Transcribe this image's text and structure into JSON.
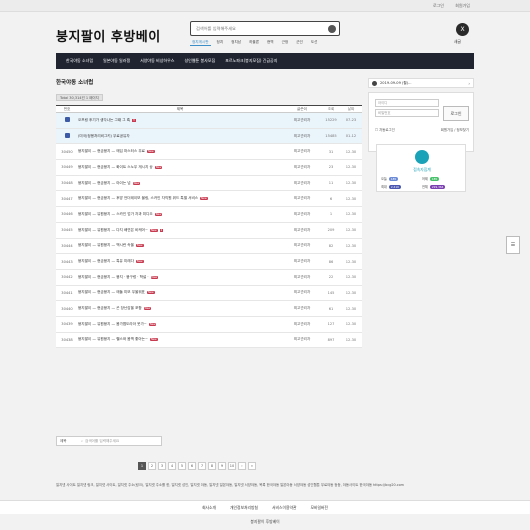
{
  "top_links": [
    "로그인",
    "회원가입"
  ],
  "logo": "붕지팔이 후방베이",
  "search": {
    "placeholder": "검색어를 입력해주세요"
  },
  "search_tabs": [
    "정치게시판",
    "정치",
    "정치남",
    "하울론",
    "현역",
    "근정",
    "군인",
    "도선"
  ],
  "user": {
    "avatar": "X",
    "label": "새글"
  },
  "nav": [
    "한국야동 소녀럽",
    "일본야동 일러쟁",
    "서양야동 비상하우스",
    "성인웹툰 봉사모집",
    "포르노파크(붕지모집) 긴급공지"
  ],
  "board": {
    "title": "한국야동 소녀럽",
    "total": "Total 30,314건 1 페이지",
    "headers": {
      "no": "번호",
      "title": "제목",
      "author": "글쓴이",
      "views": "조회",
      "date": "날짜"
    },
    "rows": [
      {
        "no": "",
        "notice": true,
        "title": "오프링 후기가 생각나는 그때 그 혹",
        "cnt": "3",
        "author": "최고관리자",
        "views": "15229",
        "date": "07-23"
      },
      {
        "no": "",
        "notice": true,
        "title": "(미국)정용처리비그키) 무료공유자",
        "cnt": "",
        "author": "최고관리자",
        "views": "15485",
        "date": "01-12"
      },
      {
        "no": "30450",
        "title": "붕지팔이 — 현금붕지 — 매입 마스터스 무료",
        "badge": "New",
        "author": "최고관리자",
        "views": "31",
        "date": "12-30"
      },
      {
        "no": "30449",
        "title": "붕지팔이 — 현금붕지 — 화이트 스노우 게시지 상",
        "badge": "New",
        "author": "최고관리자",
        "views": "23",
        "date": "12-30"
      },
      {
        "no": "30448",
        "title": "붕지팔이 — 현금붕지 — 야이는 넘",
        "badge": "New",
        "author": "최고관리자",
        "views": "11",
        "date": "12-30"
      },
      {
        "no": "30447",
        "title": "붕지팔이 — 현금붕지 — 후방 언더테이보 블링, 스카인 자직원 위드 특별 서비스",
        "badge": "New",
        "author": "최고관리자",
        "views": "6",
        "date": "12-30"
      },
      {
        "no": "30446",
        "title": "붕지팔이 — 유원붕지 — 스카인 업가 자과 미디오",
        "badge": "New",
        "author": "최고관리자",
        "views": "1",
        "date": "12-30"
      },
      {
        "no": "30445",
        "title": "붕지팔이 — 유원붕지 — 다지 배연은 비케어~",
        "badge": "New",
        "cnt": "2",
        "author": "최고관리자",
        "views": "209",
        "date": "12-30"
      },
      {
        "no": "30444",
        "title": "붕지팔이 — 유원붕지 — 백시런 속을",
        "badge": "New",
        "author": "최고관리자",
        "views": "82",
        "date": "12-30"
      },
      {
        "no": "30443",
        "title": "붕지팔이 — 현금붕지 — 특유 미레다",
        "badge": "New",
        "author": "최고관리자",
        "views": "86",
        "date": "12-30"
      },
      {
        "no": "30442",
        "title": "붕지팔이 — 현금붕지 — 붕지 · 붕구렁 · 학설 ·",
        "badge": "New",
        "author": "최고관리자",
        "views": "22",
        "date": "12-30"
      },
      {
        "no": "30441",
        "title": "붕지팔이 — 현금붕지 — 애돌 미모 우울워표",
        "badge": "New",
        "author": "최고관리자",
        "views": "145",
        "date": "12-30"
      },
      {
        "no": "30440",
        "title": "붕지팔이 — 현금붕지 — 곤 장난감을 포함",
        "badge": "New",
        "author": "최고관리자",
        "views": "61",
        "date": "12-30"
      },
      {
        "no": "30439",
        "title": "붕지팔이 — 유원붕지 — 몸가볍도라아 옷가~",
        "badge": "New",
        "author": "최고관리자",
        "views": "127",
        "date": "12-30"
      },
      {
        "no": "30438",
        "title": "붕지팔이 — 유원붕지 — 헬스와 몸맥 좋아는~",
        "badge": "New",
        "author": "최고관리자",
        "views": "897",
        "date": "12-30"
      }
    ],
    "search_select": "제목",
    "search_placeholder": "검색어를 입력해주세요"
  },
  "pagination": [
    "1",
    "2",
    "3",
    "4",
    "5",
    "6",
    "7",
    "8",
    "9",
    "10",
    "›",
    "»"
  ],
  "sidebar": {
    "date": "2019-09-09 (월)...",
    "login_id": "아이디",
    "login_pw": "비밀번호",
    "login_btn": "로그인",
    "auto_login": "자동로그인",
    "signup": "회원가입",
    "find": "정보찾기",
    "visitor_title": "접속자집계",
    "visitor": [
      {
        "label": "오늘",
        "value": "185",
        "color": "#6c8bd6"
      },
      {
        "label": "어제",
        "value": "185",
        "color": "#47c26a"
      },
      {
        "label": "최대",
        "value": "2,410",
        "color": "#4a56b0"
      },
      {
        "label": "전체",
        "value": "229,364",
        "color": "#7a3fb0"
      }
    ]
  },
  "float_btn": "☰",
  "footer": {
    "text": "일지넷 사이트 일지넷 링크, 일지넷 사이트, 일지넷 주소(링크), 일지넷 주소를 한, 일지넷 성인, 일지넷 야동, 일지넷 일본야동, 일지넷 서양야동, 목록 한국야동 일본야동 서양야동 성인웹툰 무료야동 등등, 야동사이트 한국야동 https://bcg20.com",
    "nav": [
      "회사소개",
      "개인정보처리방침",
      "서비스이용약관",
      "모바일버전"
    ],
    "name": "붕지팔이 후방베이"
  }
}
